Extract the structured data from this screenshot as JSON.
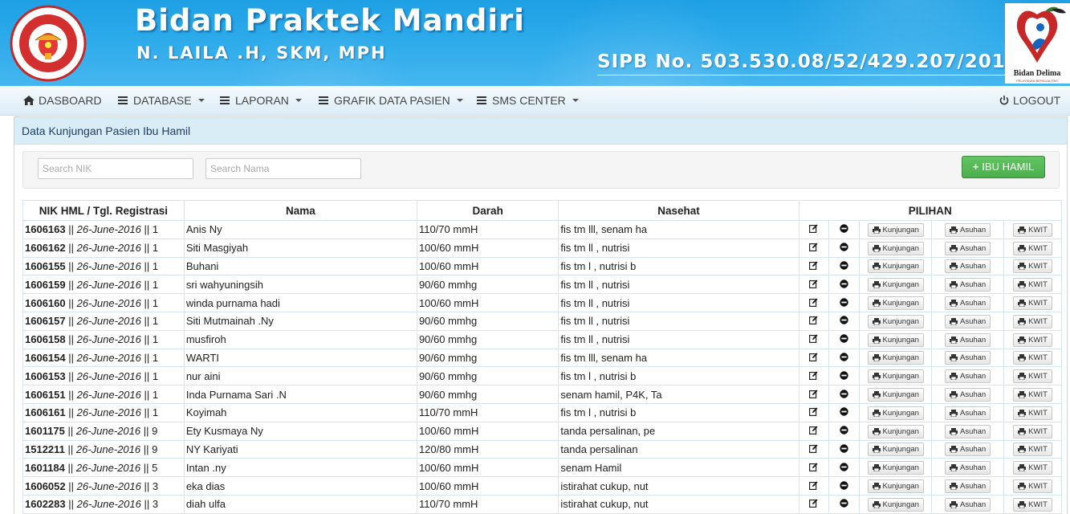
{
  "header": {
    "title": "Bidan Praktek Mandiri",
    "subtitle": "N. LAILA .H, SKM, MPH",
    "sipb": "SIPB No. 503.530.08/52/429.207/2013",
    "logo_left_text": "IKATAN BIDAN INDONESIA",
    "logo_right_text": "Bidan Delima",
    "logo_right_subtext": "PELAYANAN BERKUALITAS"
  },
  "nav": {
    "dashboard": "DASBOARD",
    "database": "DATABASE",
    "laporan": "LAPORAN",
    "grafik": "GRAFIK DATA PASIEN",
    "sms": "SMS CENTER",
    "logout": "LOGOUT"
  },
  "panel": {
    "heading": "Data Kunjungan Pasien Ibu Hamil",
    "search_nik_placeholder": "Search NIK",
    "search_nama_placeholder": "Search Nama",
    "add_button": "IBU HAMIL"
  },
  "table": {
    "headers": {
      "nik": "NIK HML / Tgl. Registrasi",
      "nama": "Nama",
      "darah": "Darah",
      "nasehat": "Nasehat",
      "pilihan": "PILIHAN"
    },
    "buttons": {
      "kunjungan": "Kunjungan",
      "asuhan": "Asuhan",
      "kwit": "KWIT"
    },
    "rows": [
      {
        "nik": "1606163",
        "date": "26-June-2016",
        "no": "1",
        "nama": "Anis Ny",
        "darah": "110/70 mmH",
        "nasehat": "fis tm lll, senam ha"
      },
      {
        "nik": "1606162",
        "date": "26-June-2016",
        "no": "1",
        "nama": "Siti Masgiyah",
        "darah": "100/60 mmH",
        "nasehat": "fis tm ll , nutrisi"
      },
      {
        "nik": "1606155",
        "date": "26-June-2016",
        "no": "1",
        "nama": "Buhani",
        "darah": "100/60 mmH",
        "nasehat": "fis tm l , nutrisi b"
      },
      {
        "nik": "1606159",
        "date": "26-June-2016",
        "no": "1",
        "nama": "sri wahyuningsih",
        "darah": "90/60 mmhg",
        "nasehat": "fis tm ll , nutrisi"
      },
      {
        "nik": "1606160",
        "date": "26-June-2016",
        "no": "1",
        "nama": "winda purnama hadi",
        "darah": "100/60 mmH",
        "nasehat": "fis tm ll , nutrisi"
      },
      {
        "nik": "1606157",
        "date": "26-June-2016",
        "no": "1",
        "nama": "Siti Mutmainah .Ny",
        "darah": "90/60 mmhg",
        "nasehat": "fis tm ll , nutrisi"
      },
      {
        "nik": "1606158",
        "date": "26-June-2016",
        "no": "1",
        "nama": "musfiroh",
        "darah": "90/60 mmhg",
        "nasehat": "fis tm ll , nutrisi"
      },
      {
        "nik": "1606154",
        "date": "26-June-2016",
        "no": "1",
        "nama": "WARTI",
        "darah": "90/60 mmhg",
        "nasehat": "fis tm lll, senam ha"
      },
      {
        "nik": "1606153",
        "date": "26-June-2016",
        "no": "1",
        "nama": "nur aini",
        "darah": "90/60 mmhg",
        "nasehat": "fis tm l , nutrisi b"
      },
      {
        "nik": "1606151",
        "date": "26-June-2016",
        "no": "1",
        "nama": "Inda Purnama Sari .N",
        "darah": "90/60 mmhg",
        "nasehat": "senam hamil, P4K, Ta"
      },
      {
        "nik": "1606161",
        "date": "26-June-2016",
        "no": "1",
        "nama": "Koyimah",
        "darah": "110/70 mmH",
        "nasehat": "fis tm l , nutrisi b"
      },
      {
        "nik": "1601175",
        "date": "26-June-2016",
        "no": "9",
        "nama": "Ety Kusmaya Ny",
        "darah": "100/60 mmH",
        "nasehat": "tanda persalinan, pe"
      },
      {
        "nik": "1512211",
        "date": "26-June-2016",
        "no": "9",
        "nama": "NY Kariyati",
        "darah": "120/80 mmH",
        "nasehat": "tanda persalinan"
      },
      {
        "nik": "1601184",
        "date": "26-June-2016",
        "no": "5",
        "nama": "Intan .ny",
        "darah": "100/60 mmH",
        "nasehat": "senam Hamil"
      },
      {
        "nik": "1606052",
        "date": "26-June-2016",
        "no": "3",
        "nama": "eka dias",
        "darah": "100/60 mmH",
        "nasehat": "istirahat cukup, nut"
      },
      {
        "nik": "1602283",
        "date": "26-June-2016",
        "no": "3",
        "nama": "diah ulfa",
        "darah": "110/70 mmH",
        "nasehat": "istirahat cukup, nut"
      }
    ]
  }
}
